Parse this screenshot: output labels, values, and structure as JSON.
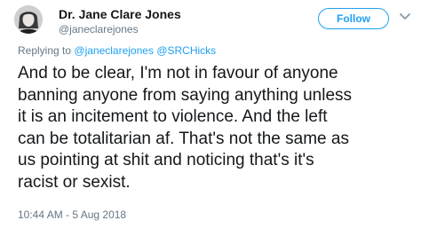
{
  "author": {
    "name": "Dr. Jane Clare Jones",
    "handle": "@janeclarejones",
    "avatar_icon": "profile-photo"
  },
  "follow_label": "Follow",
  "menu_icon": "chevron-down-icon",
  "reply": {
    "prefix": "Replying to",
    "mentions": [
      "@janeclarejones",
      "@SRCHicks"
    ]
  },
  "tweet_lines": [
    "And to be clear, I'm not in favour of anyone",
    "banning anyone from saying anything unless",
    "it is an incitement to violence. And the left",
    "can be totalitarian af. That's not the same as",
    "us pointing at shit and noticing that's it's",
    "racist or sexist."
  ],
  "timestamp": "10:44 AM - 5 Aug 2018",
  "colors": {
    "accent": "#1da1f2",
    "text": "#14171a",
    "muted": "#657786"
  }
}
